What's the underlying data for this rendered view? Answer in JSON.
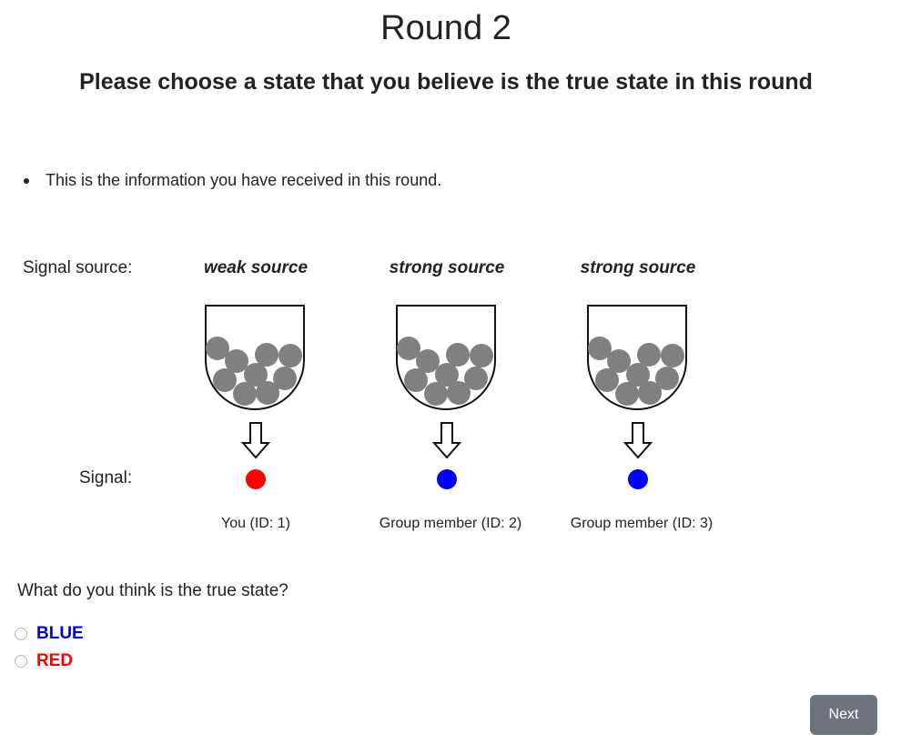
{
  "header": {
    "title": "Round 2",
    "subtitle": "Please choose a state that you believe is the true state in this round"
  },
  "info": {
    "bullet": "This is the information you have received in this round."
  },
  "labels": {
    "signal_source": "Signal source:",
    "signal": "Signal:"
  },
  "sources": [
    {
      "strength": "weak source",
      "signal_color": "#ff0000",
      "member": "You (ID: 1)"
    },
    {
      "strength": "strong source",
      "signal_color": "#0000ff",
      "member": "Group member (ID: 2)"
    },
    {
      "strength": "strong source",
      "signal_color": "#0000ff",
      "member": "Group member (ID: 3)"
    }
  ],
  "question": {
    "text": "What do you think is the true state?",
    "options": [
      {
        "label": "BLUE",
        "color": "#0000e0"
      },
      {
        "label": "RED",
        "color": "#ff0000"
      }
    ]
  },
  "footer": {
    "next_label": "Next"
  },
  "colors": {
    "ball": "#808080",
    "button": "#6c757d"
  }
}
